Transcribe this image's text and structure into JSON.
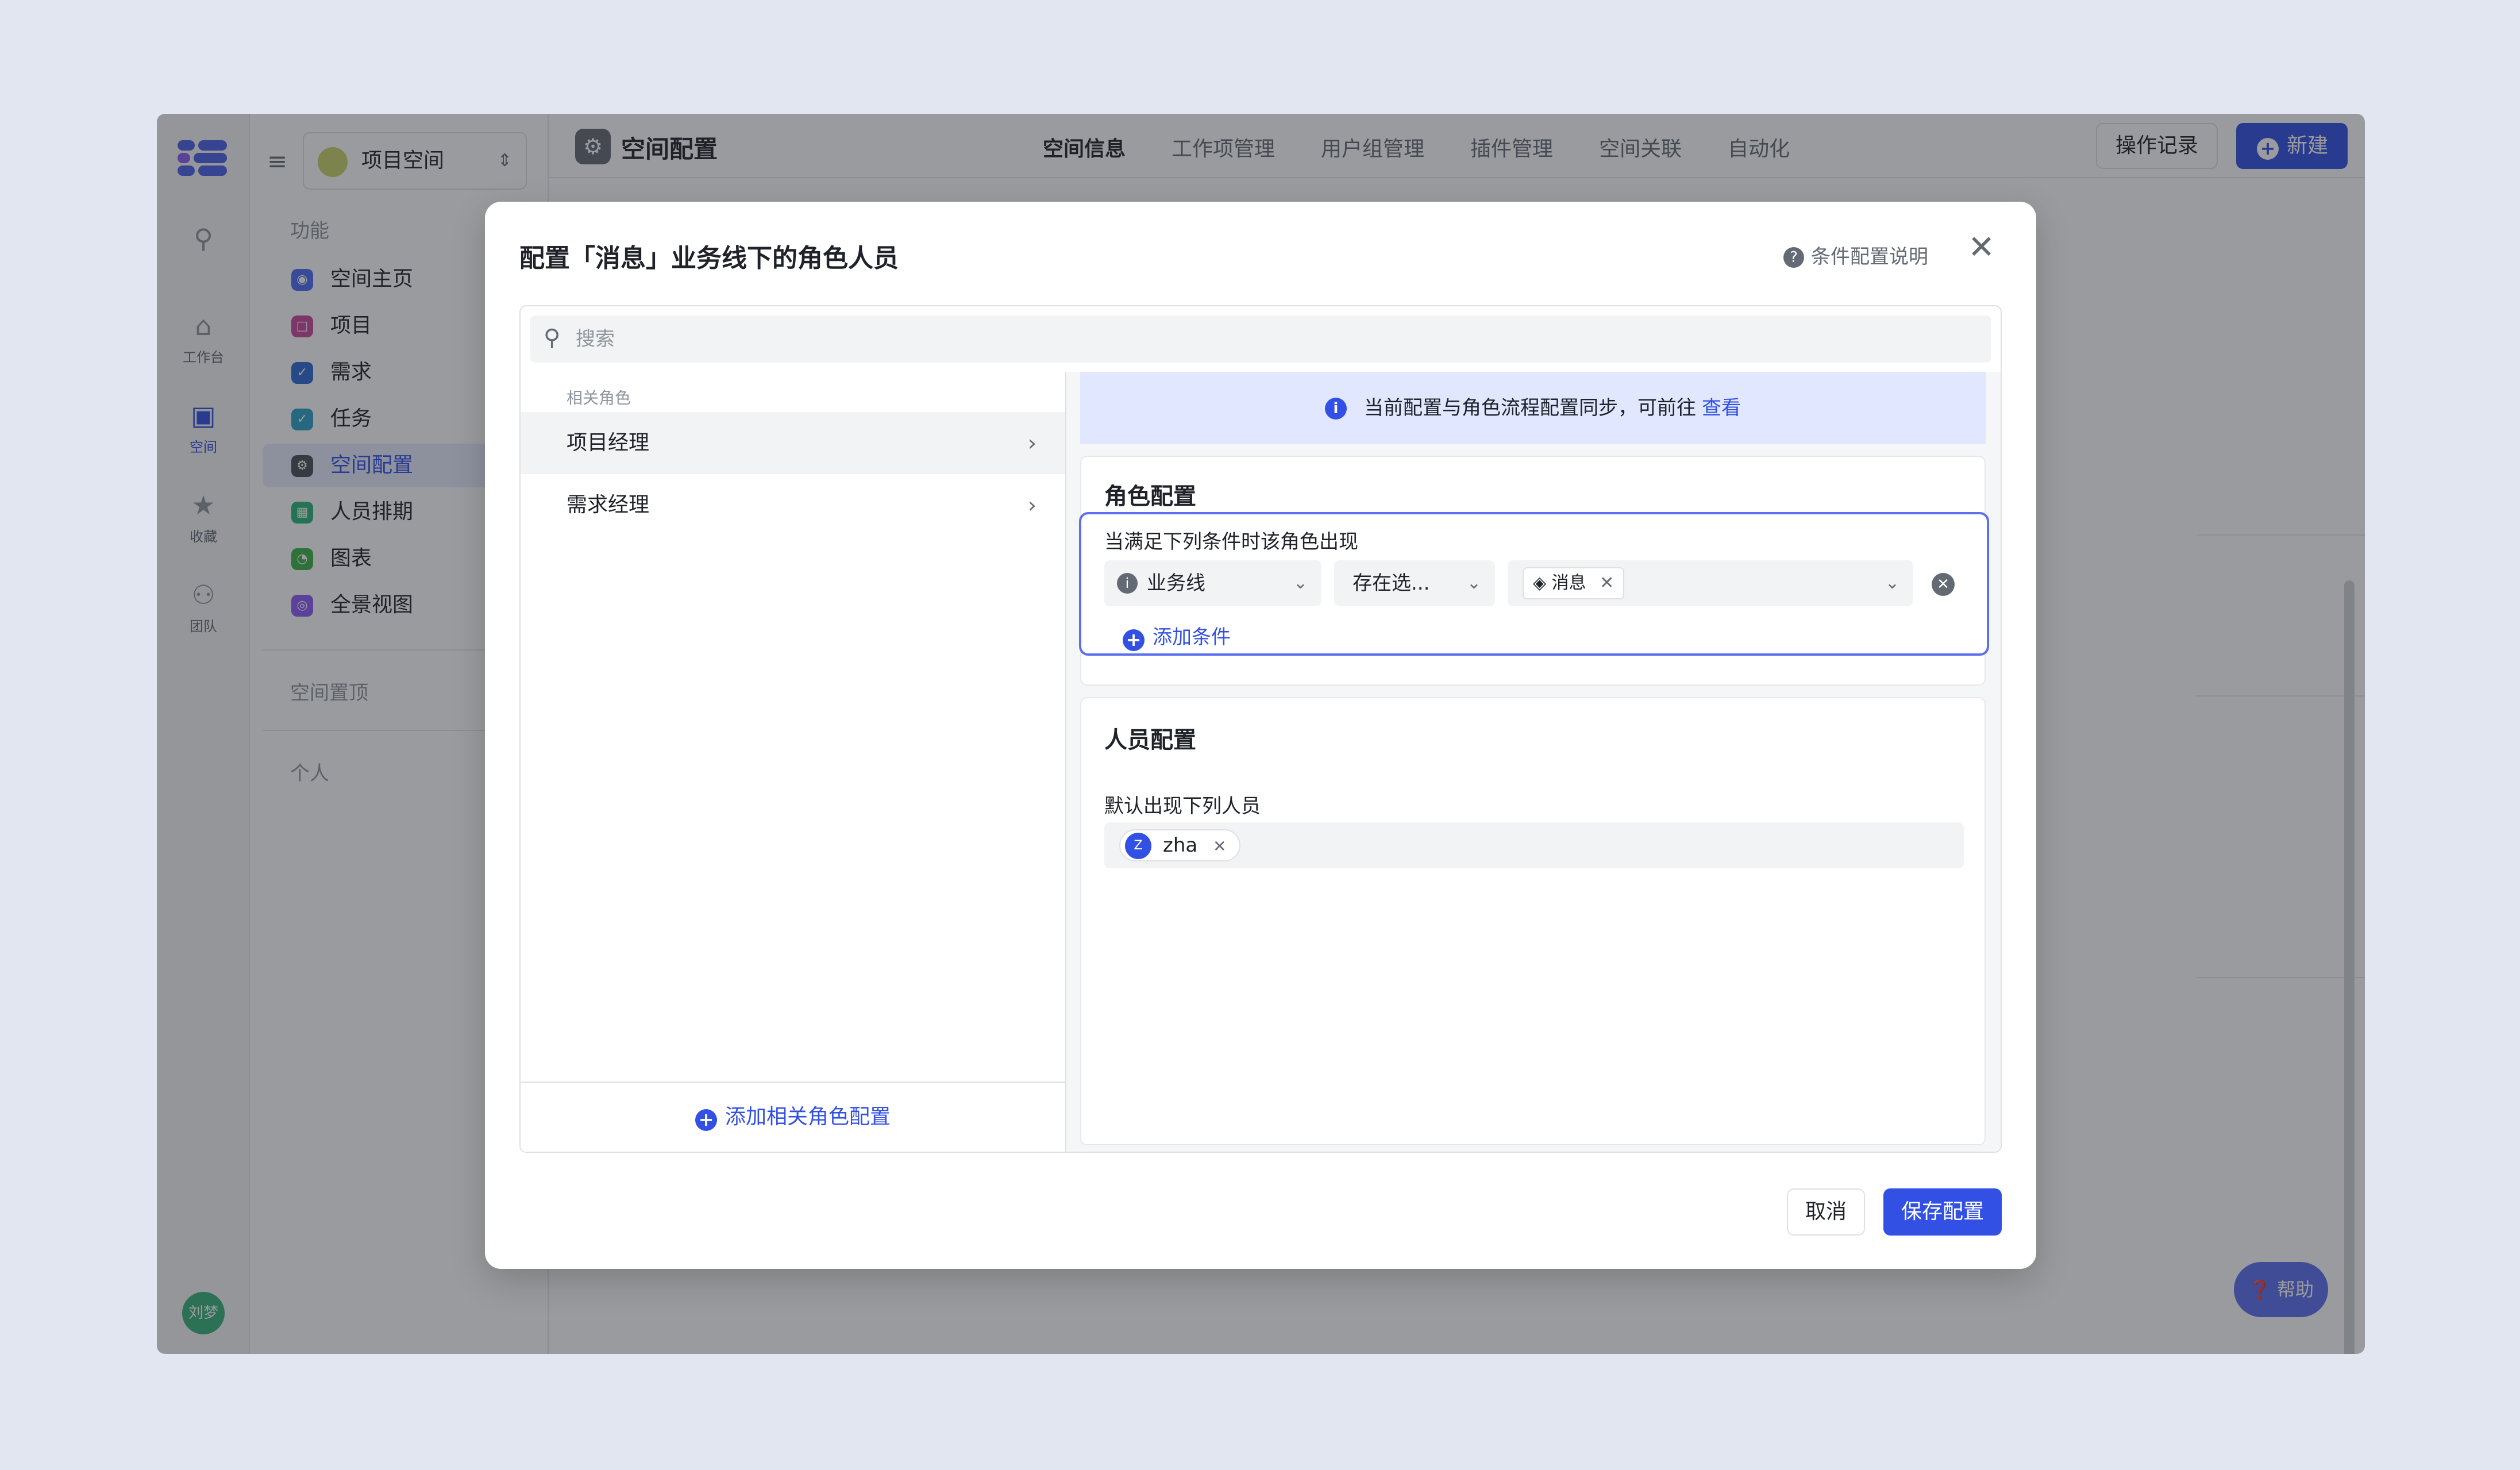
{
  "rail": {
    "items": [
      {
        "label": "",
        "icon": "search-icon"
      },
      {
        "label": "工作台",
        "icon": "home-icon"
      },
      {
        "label": "空间",
        "icon": "space-icon"
      },
      {
        "label": "收藏",
        "icon": "star-icon"
      },
      {
        "label": "团队",
        "icon": "team-icon"
      }
    ],
    "avatar_label": "刘梦"
  },
  "sidebar": {
    "space_name": "项目空间",
    "section_features": "功能",
    "items": [
      {
        "label": "空间主页",
        "color": "#4c6ef5"
      },
      {
        "label": "项目",
        "color": "#c8489c"
      },
      {
        "label": "需求",
        "color": "#2f6bd8"
      },
      {
        "label": "任务",
        "color": "#2ea3c8"
      },
      {
        "label": "空间配置",
        "color": "#4a4f57"
      },
      {
        "label": "人员排期",
        "color": "#2db57a"
      },
      {
        "label": "图表",
        "color": "#3bb54a"
      },
      {
        "label": "全景视图",
        "color": "#8a5cf6"
      }
    ],
    "section_pinned": "空间置顶",
    "section_personal": "个人"
  },
  "topbar": {
    "title": "空间配置",
    "tabs": [
      "空间信息",
      "工作项管理",
      "用户组管理",
      "插件管理",
      "空间关联",
      "自动化"
    ],
    "log_button": "操作记录",
    "new_button": "新建"
  },
  "help_fab": "帮助",
  "modal": {
    "title": "配置「消息」业务线下的角色人员",
    "help_link": "条件配置说明",
    "search_placeholder": "搜索",
    "roles_label": "相关角色",
    "roles": [
      "项目经理",
      "需求经理"
    ],
    "add_role_config": "添加相关角色配置",
    "notice_text": "当前配置与角色流程配置同步，可前往",
    "notice_link": "查看",
    "role_config": {
      "title": "角色配置",
      "condition_title": "当满足下列条件时该角色出现",
      "field": "业务线",
      "operator": "存在选...",
      "value_tag": "消息",
      "add_condition": "添加条件"
    },
    "people_config": {
      "title": "人员配置",
      "default_label": "默认出现下列人员",
      "person_initial": "Z",
      "person_name": "zha"
    },
    "cancel_button": "取消",
    "save_button": "保存配置"
  },
  "colors": {
    "primary": "#3250e4",
    "focus_border": "#5b6ff0",
    "notice_bg": "#e1e7fe"
  }
}
